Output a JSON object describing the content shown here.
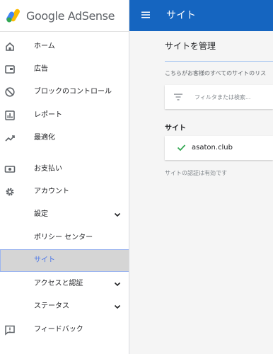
{
  "app": {
    "logo_text": "Google AdSense",
    "brand_color": "#1565c0",
    "accent_color": "#4a76e8"
  },
  "sidebar": {
    "items": [
      {
        "label": "ホーム",
        "icon": "home-icon"
      },
      {
        "label": "広告",
        "icon": "ads-icon"
      },
      {
        "label": "ブロックのコントロール",
        "icon": "block-icon"
      },
      {
        "label": "レポート",
        "icon": "reports-icon"
      },
      {
        "label": "最適化",
        "icon": "optimization-icon"
      },
      {
        "label": "お支払い",
        "icon": "payments-icon"
      },
      {
        "label": "アカウント",
        "icon": "gear-icon"
      },
      {
        "label": "設定",
        "icon": "chevron-down-icon"
      },
      {
        "label": "ポリシー センター"
      },
      {
        "label": "サイト",
        "active": true
      },
      {
        "label": "アクセスと認証",
        "icon": "chevron-down-icon"
      },
      {
        "label": "ステータス",
        "icon": "chevron-down-icon"
      },
      {
        "label": "フィードバック",
        "icon": "feedback-icon"
      }
    ]
  },
  "header": {
    "title": "サイト"
  },
  "main": {
    "manage_title": "サイトを管理",
    "description": "こちらがお客様のすべてのサイトのリス",
    "filter": {
      "placeholder": "フィルタまたは検索..."
    },
    "sites_heading": "サイト",
    "sites": [
      {
        "name": "asaton.club",
        "status_icon": "check-icon"
      }
    ],
    "status_text": "サイトの認証は有効です"
  }
}
